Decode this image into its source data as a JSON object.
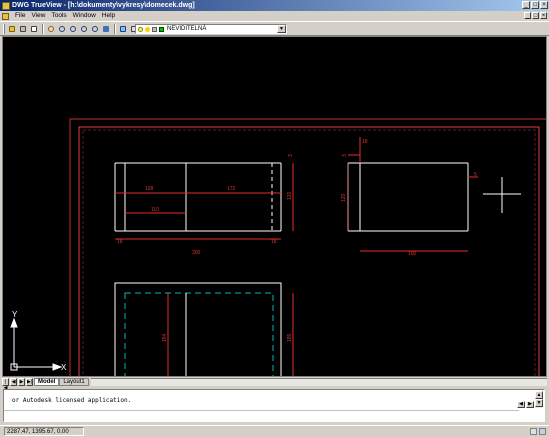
{
  "window": {
    "title": "DWG TrueView - [h:\\dokumenty\\vykresy\\domecek.dwg]",
    "min_label": "_",
    "max_label": "□",
    "close_label": "×"
  },
  "menu": {
    "items": [
      "File",
      "View",
      "Tools",
      "Window",
      "Help"
    ],
    "doc_min_label": "_",
    "doc_max_label": "□",
    "doc_close_label": "×"
  },
  "toolbar": {
    "buttons": [
      "open-icon",
      "print-icon",
      "preview-icon",
      "pan-icon",
      "zoom-realtime-icon",
      "zoom-window-icon",
      "zoom-extents-icon",
      "zoom-previous-icon",
      "regen-icon",
      "layers-icon",
      "layer-previous-icon",
      "properties-icon"
    ],
    "layer_name": "NEVIDITELNÁ",
    "layer_icons": [
      "lightbulb-icon",
      "sun-icon",
      "lock-icon",
      "color-swatch-icon"
    ],
    "drop_label": "▼"
  },
  "drawing": {
    "dimensions": {
      "d1": "128",
      "d2": "172",
      "d3": "110",
      "d4": "120",
      "d5": "18",
      "d6": "18",
      "d7": "300",
      "d8": "3",
      "d9": "18",
      "d10": "3",
      "d11": "120",
      "d12": "5",
      "d13": "190",
      "d14": "154",
      "d15": "195"
    },
    "ucs": {
      "x_label": "X",
      "y_label": "Y"
    },
    "colors": {
      "background": "#000000",
      "border_red": "#e03030",
      "lines": "#ffffff",
      "hidden": "#00c0c0",
      "dim": "#e03030"
    }
  },
  "tabs": {
    "nav": [
      "|◀",
      "◀",
      "▶",
      "▶|"
    ],
    "items": [
      {
        "label": "Model",
        "active": true
      },
      {
        "label": "Layout1",
        "active": false
      }
    ]
  },
  "command": {
    "text": "or Autodesk licensed application.",
    "prompt": ""
  },
  "status": {
    "coordinates": "2287.47, 1395.67, 0.00"
  }
}
